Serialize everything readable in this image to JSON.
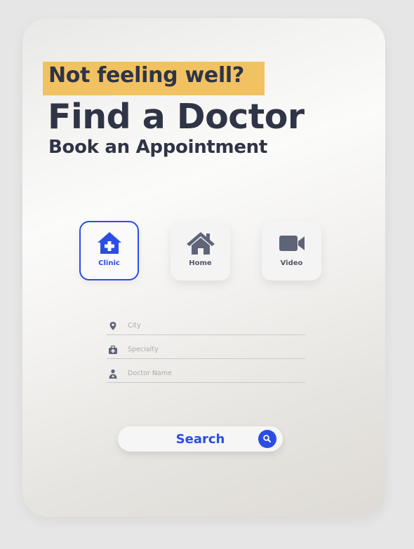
{
  "header": {
    "tagline": "Not feeling well?",
    "title": "Find a Doctor",
    "subtitle": "Book an Appointment"
  },
  "modes": [
    {
      "label": "Clinic",
      "icon": "hospital-icon",
      "selected": true
    },
    {
      "label": "Home",
      "icon": "home-icon",
      "selected": false
    },
    {
      "label": "Video",
      "icon": "video-camera-icon",
      "selected": false
    }
  ],
  "form": {
    "city": {
      "placeholder": "City",
      "value": "",
      "icon": "map-pin-icon"
    },
    "specialty": {
      "placeholder": "Specialty",
      "value": "",
      "icon": "medical-kit-icon"
    },
    "doctor_name": {
      "placeholder": "Doctor Name",
      "value": "",
      "icon": "doctor-icon"
    }
  },
  "search": {
    "label": "Search",
    "icon": "search-icon"
  },
  "colors": {
    "accent": "#2b4de4",
    "highlight": "#f1c261",
    "text_dark": "#2f3446",
    "icon_gray": "#5f6478"
  }
}
